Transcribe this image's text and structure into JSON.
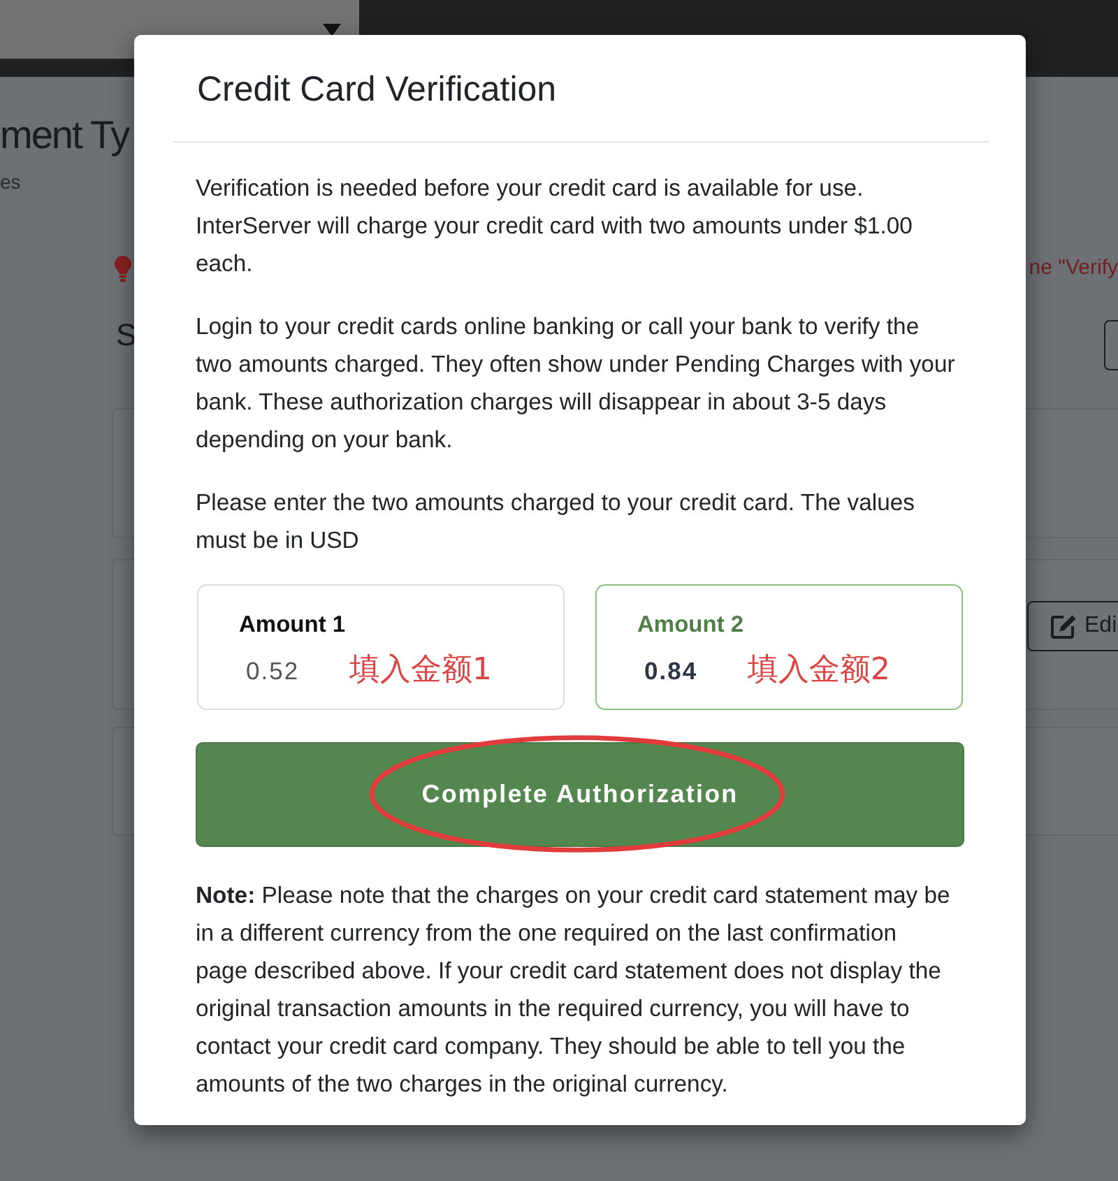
{
  "background_page": {
    "heading": "ment Ty",
    "subtitle": "es",
    "notice_text": "ne \"Verify",
    "section_heading": "S",
    "edit_button": "Edi"
  },
  "modal": {
    "title": "Credit Card Verification",
    "paragraphs": [
      "Verification is needed before your credit card is available for use. InterServer will charge your credit card with two amounts under $1.00 each.",
      "Login to your credit cards online banking or call your bank to verify the two amounts charged. They often show under Pending Charges with your bank. These authorization charges will disappear in about 3-5 days depending on your bank.",
      "Please enter the two amounts charged to your credit card. The values must be in USD"
    ],
    "amounts": [
      {
        "label": "Amount 1",
        "value": "0.52",
        "focused": false,
        "annotation": "填入金额1"
      },
      {
        "label": "Amount 2",
        "value": "0.84",
        "focused": true,
        "annotation": "填入金额2"
      }
    ],
    "submit_button": {
      "label": "Complete Authorization",
      "highlighted": true
    },
    "note": "**Note:** Please note that the charges on your credit card statement may be in a different currency from the one required on the last confirmation page described above. If your credit card statement does not display the original transaction amounts in the required currency, you will have to contact your credit card company. They should be able to tell you the amounts of the two charges in the original currency."
  }
}
